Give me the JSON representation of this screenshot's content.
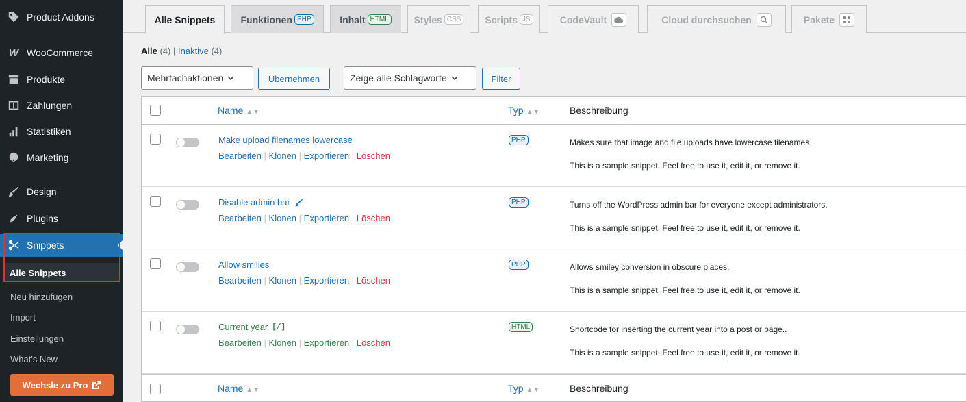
{
  "sidebar": {
    "items": [
      {
        "label": "Product Addons",
        "icon": "tag-icon"
      },
      {
        "label": "WooCommerce",
        "icon": "woo-icon"
      },
      {
        "label": "Produkte",
        "icon": "archive-icon"
      },
      {
        "label": "Zahlungen",
        "icon": "payment-icon"
      },
      {
        "label": "Statistiken",
        "icon": "bar-chart-icon"
      },
      {
        "label": "Marketing",
        "icon": "megaphone-icon"
      },
      {
        "label": "Design",
        "icon": "brush-icon"
      },
      {
        "label": "Plugins",
        "icon": "plug-icon"
      },
      {
        "label": "Snippets",
        "icon": "scissors-icon"
      }
    ],
    "submenu": {
      "current": "Alle Snippets",
      "items": [
        "Neu hinzufügen",
        "Import",
        "Einstellungen",
        "What's New"
      ]
    },
    "pro_button": "Wechsle zu Pro"
  },
  "tabs": [
    {
      "label": "Alle Snippets",
      "badge": ""
    },
    {
      "label": "Funktionen",
      "badge": "PHP"
    },
    {
      "label": "Inhalt",
      "badge": "HTML"
    },
    {
      "label": "Styles",
      "badge": "CSS"
    },
    {
      "label": "Scripts",
      "badge": "JS"
    },
    {
      "label": "CodeVault",
      "badge": ""
    },
    {
      "label": "Cloud durchsuchen",
      "badge": ""
    },
    {
      "label": "Pakete",
      "badge": ""
    }
  ],
  "views": {
    "all_label": "Alle",
    "all_count": "(4)",
    "sep": "|",
    "inactive_label": "Inaktive",
    "inactive_count": "(4)"
  },
  "bulk": {
    "select_label": "Mehrfachaktionen",
    "apply_label": "Übernehmen",
    "tags_label": "Zeige alle Schlagworte",
    "filter_label": "Filter"
  },
  "table": {
    "columns": {
      "name": "Name",
      "type": "Typ",
      "description": "Beschreibung"
    },
    "actions": {
      "edit": "Bearbeiten",
      "clone": "Klonen",
      "export": "Exportieren",
      "delete": "Löschen",
      "sep": "|"
    },
    "rows": [
      {
        "name": "Make upload filenames lowercase",
        "type": "PHP",
        "desc": "Makes sure that image and file uploads have lowercase filenames.",
        "note": "This is a sample snippet. Feel free to use it, edit it, or remove it.",
        "marker": ""
      },
      {
        "name": "Disable admin bar",
        "type": "PHP",
        "desc": "Turns off the WordPress admin bar for everyone except administrators.",
        "note": "This is a sample snippet. Feel free to use it, edit it, or remove it.",
        "marker": "pin-icon"
      },
      {
        "name": "Allow smilies",
        "type": "PHP",
        "desc": "Allows smiley conversion in obscure places.",
        "note": "This is a sample snippet. Feel free to use it, edit it, or remove it.",
        "marker": ""
      },
      {
        "name": "Current year",
        "type": "HTML",
        "desc": "Shortcode for inserting the current year into a post or page..",
        "note": "This is a sample snippet. Feel free to use it, edit it, or remove it.",
        "marker": "[/]"
      }
    ]
  }
}
